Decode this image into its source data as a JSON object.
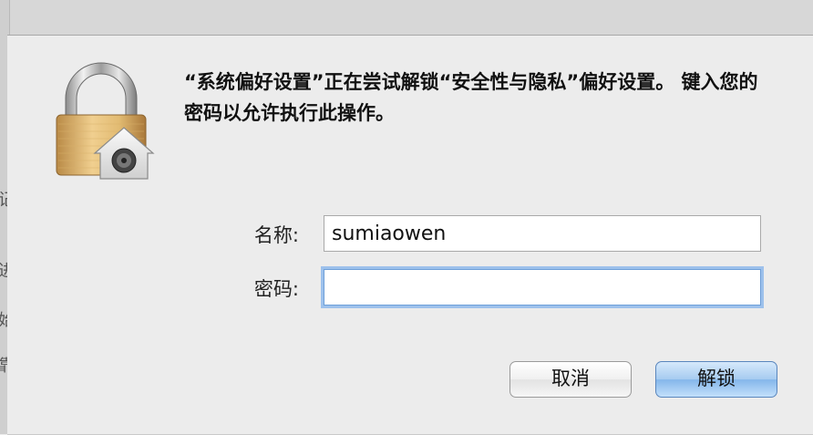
{
  "dialog": {
    "message": "“系统偏好设置”正在尝试解锁“安全性与隐私”偏好设置。 键入您的密码以允许执行此操作。",
    "name_label": "名称:",
    "name_value": "sumiaowen",
    "password_label": "密码:",
    "password_value": "",
    "cancel_label": "取消",
    "unlock_label": "解锁"
  },
  "background": {
    "glyphs": [
      "记",
      "进",
      "始",
      "靠"
    ]
  },
  "icons": {
    "lock": "padlock-icon",
    "home": "house-keyhole-icon"
  },
  "colors": {
    "sheet_bg": "#ececec",
    "default_button": "#a6cbf0",
    "focus_ring": "#9dc1ec"
  }
}
